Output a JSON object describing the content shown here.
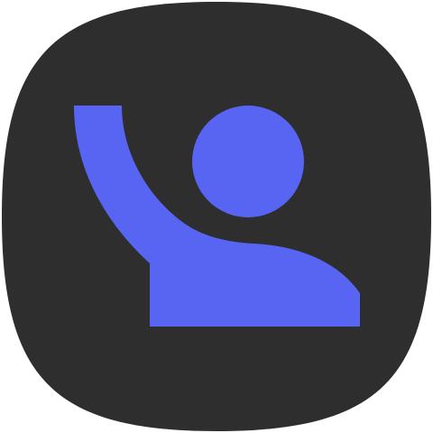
{
  "icon": {
    "name": "raised-hand-person-icon",
    "background_color": "#2e2e2e",
    "glyph_color": "#5865f2"
  }
}
